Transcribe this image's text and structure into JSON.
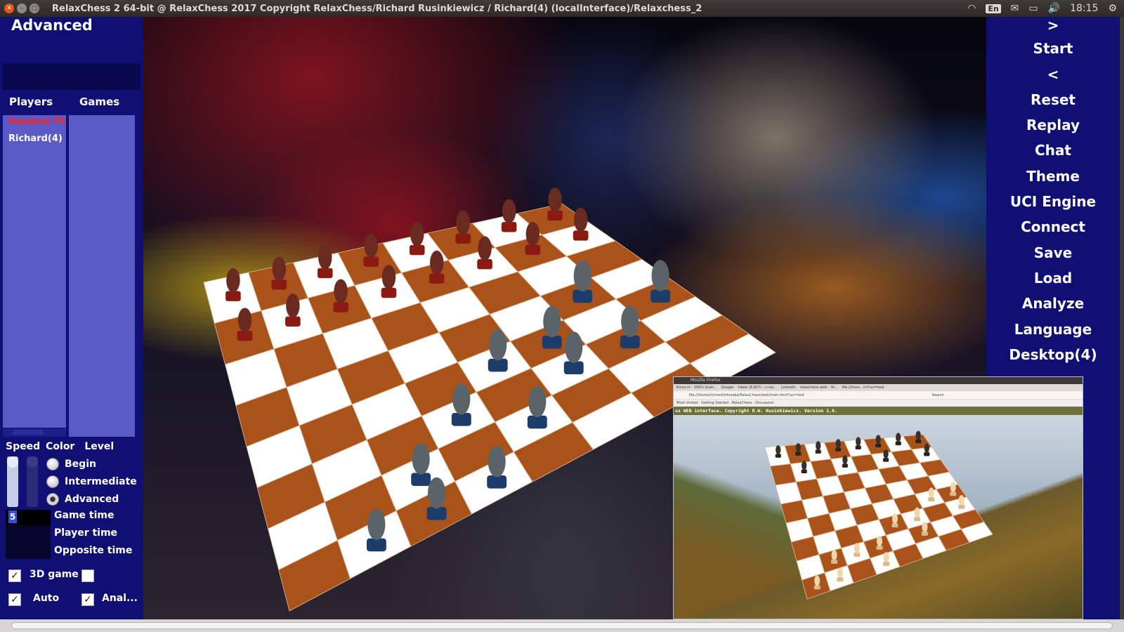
{
  "window": {
    "title": "RelaxChess 2 64-bit @ RelaxChess 2017 Copyright RelaxChess/Richard Rusinkiewicz  / Richard(4) (localInterface)/Relaxchess_2",
    "keyboard": "En",
    "time": "18:15"
  },
  "left_panel": {
    "mode": "Advanced",
    "players_tab": "Players",
    "games_tab": "Games",
    "players": [
      "Random Pla",
      "Richard(4)"
    ],
    "speed_label": "Speed",
    "color_label": "Color",
    "level_label": "Level",
    "levels": [
      "Begin",
      "Intermediate",
      "Advanced"
    ],
    "selected_level": "Advanced",
    "game_time_value": "5",
    "game_time_label": "Game time",
    "player_time_label": "Player time",
    "opposite_time_label": "Opposite time",
    "game3d_label": "3D game",
    "game3d_checked": true,
    "auto_label": "Auto",
    "auto_checked": true,
    "anal_label": "Anal...",
    "anal_checked": true
  },
  "right_menu": {
    "items": [
      ">",
      "Start",
      "<",
      "Reset",
      "Replay",
      "Chat",
      "Theme",
      "UCI Engine",
      "Connect",
      "Save",
      "Load",
      "Analyze",
      "Language",
      "Desktop(4)"
    ]
  },
  "browser_inset": {
    "title": "Mozilla Firefox",
    "tabs": [
      "Kinoz.nl - 100% Grati...",
      "Google",
      "Inbox (9,907) - r.rusi...",
      "LinkedIn",
      "relaxchess web - Yo...",
      "file:///hom...ml?uci=test"
    ],
    "url": "file:///home/richard/infosaba/RelaxChess/web/main.html?uci=test",
    "search_placeholder": "Search",
    "bookmarks": [
      "Most Visited",
      "Getting Started",
      "RelaxChess",
      "Discussion"
    ],
    "page_header": "ss WEB interface. Copyright R.W. Rusinkiewicz. Version 1.0."
  },
  "colors": {
    "panel_blue": "#100f73",
    "list_blue": "#5b5bc7",
    "dark_square": "#a9531a",
    "light_square": "#ffffff",
    "selected_player": "#ff2020"
  }
}
